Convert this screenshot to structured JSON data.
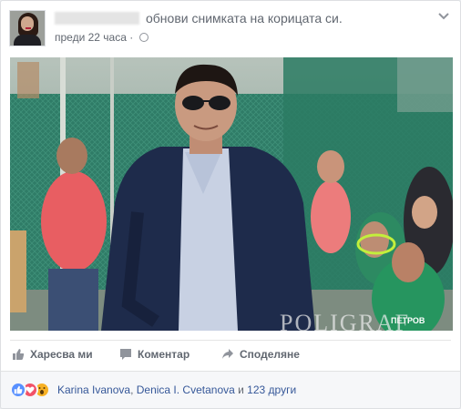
{
  "post": {
    "action_text": "обнови снимката на корицата си.",
    "time": "преди 22 часа",
    "privacy_icon": "globe-icon",
    "menu_icon": "chevron-down-icon"
  },
  "photo": {
    "watermark": "POLIGRAF",
    "jersey_text": "ПЕТРОВ",
    "description_colors": {
      "fence": "#2e7a64",
      "jacket": "#1d2a4a",
      "shirt": "#c7d0e2"
    }
  },
  "actions": {
    "like_label": "Харесва ми",
    "comment_label": "Коментар",
    "share_label": "Споделяне"
  },
  "reactions": {
    "icons": [
      "like-reaction-icon",
      "love-reaction-icon",
      "wow-reaction-icon"
    ],
    "name1": "Karina Ivanova",
    "separator": ", ",
    "name2": "Denica I. Cvetanova",
    "and_text": " и ",
    "others": "123 други"
  },
  "colors": {
    "link": "#365899",
    "meta": "#616770",
    "like_blue": "#5890ff",
    "love_red": "#f25268",
    "wow_yellow": "#f7b125"
  }
}
